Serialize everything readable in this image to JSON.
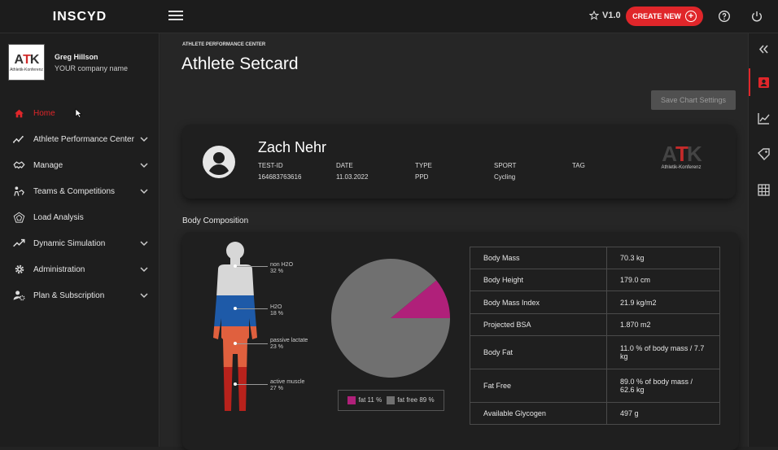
{
  "app": {
    "logo_text": "INSCYD",
    "version": "V1.0",
    "create_label": "CREATE NEW"
  },
  "user": {
    "name": "Greg Hillson",
    "company": "YOUR company name",
    "logo_big": "ATK",
    "logo_small": "Athletik-Konferenz"
  },
  "nav": [
    {
      "label": "Home",
      "icon": "home-icon",
      "active": true
    },
    {
      "label": "Athlete Performance Center",
      "icon": "trend-icon",
      "chevron": true
    },
    {
      "label": "Manage",
      "icon": "handshake-icon",
      "chevron": true
    },
    {
      "label": "Teams & Competitions",
      "icon": "team-icon",
      "chevron": true
    },
    {
      "label": "Load Analysis",
      "icon": "radar-icon",
      "chevron": false
    },
    {
      "label": "Dynamic Simulation",
      "icon": "chart-line-icon",
      "chevron": true
    },
    {
      "label": "Administration",
      "icon": "gear-icon",
      "chevron": true
    },
    {
      "label": "Plan & Subscription",
      "icon": "user-cog-icon",
      "chevron": true
    }
  ],
  "page": {
    "breadcrumb": "ATHLETE PERFORMANCE CENTER",
    "title": "Athlete Setcard",
    "save_label": "Save Chart Settings"
  },
  "athlete": {
    "name": "Zach Nehr",
    "fields": [
      {
        "label": "TEST-ID",
        "value": "164683763616"
      },
      {
        "label": "DATE",
        "value": "11.03.2022"
      },
      {
        "label": "TYPE",
        "value": "PPD"
      },
      {
        "label": "SPORT",
        "value": "Cycling"
      },
      {
        "label": "TAG",
        "value": ""
      }
    ],
    "brand_logo_big": "ATK",
    "brand_logo_small": "Athletik-Konferenz"
  },
  "composition": {
    "section_title": "Body Composition",
    "body_segments": [
      {
        "label": "non H2O",
        "value": "32 %",
        "color": "#d7d7d7"
      },
      {
        "label": "H2O",
        "value": "18 %",
        "color": "#1e5aa8"
      },
      {
        "label": "passive lactate",
        "value": "23 %",
        "color": "#e0603e"
      },
      {
        "label": "active muscle",
        "value": "27 %",
        "color": "#b8221c"
      }
    ],
    "legend": [
      {
        "label": "fat 11 %",
        "color": "#b0207a"
      },
      {
        "label": "fat free 89 %",
        "color": "#707070"
      }
    ],
    "table": [
      {
        "label": "Body Mass",
        "value": "70.3 kg"
      },
      {
        "label": "Body Height",
        "value": "179.0 cm"
      },
      {
        "label": "Body Mass Index",
        "value": "21.9 kg/m2"
      },
      {
        "label": "Projected BSA",
        "value": "1.870 m2"
      },
      {
        "label": "Body Fat",
        "value": "11.0 % of body mass / 7.7 kg"
      },
      {
        "label": "Fat Free",
        "value": "89.0 % of body mass / 62.6 kg"
      },
      {
        "label": "Available Glycogen",
        "value": "497 g"
      }
    ]
  },
  "chart_data": {
    "type": "pie",
    "categories": [
      "fat",
      "fat free"
    ],
    "values": [
      11,
      89
    ],
    "colors": [
      "#b0207a",
      "#707070"
    ]
  }
}
